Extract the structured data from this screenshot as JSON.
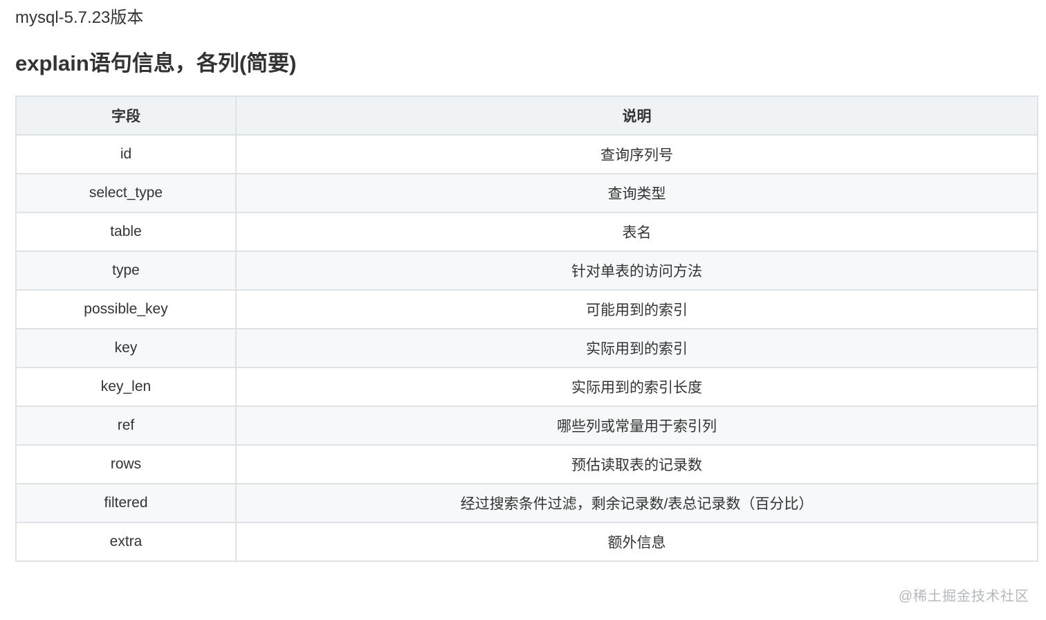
{
  "header": {
    "version_line": "mysql-5.7.23版本",
    "title": "explain语句信息，各列(简要)"
  },
  "table": {
    "columns": [
      "字段",
      "说明"
    ],
    "rows": [
      [
        "id",
        "查询序列号"
      ],
      [
        "select_type",
        "查询类型"
      ],
      [
        "table",
        "表名"
      ],
      [
        "type",
        "针对单表的访问方法"
      ],
      [
        "possible_key",
        "可能用到的索引"
      ],
      [
        "key",
        "实际用到的索引"
      ],
      [
        "key_len",
        "实际用到的索引长度"
      ],
      [
        "ref",
        "哪些列或常量用于索引列"
      ],
      [
        "rows",
        "预估读取表的记录数"
      ],
      [
        "filtered",
        "经过搜索条件过滤，剩余记录数/表总记录数（百分比）"
      ],
      [
        "extra",
        "额外信息"
      ]
    ]
  },
  "watermark": "@稀土掘金技术社区"
}
